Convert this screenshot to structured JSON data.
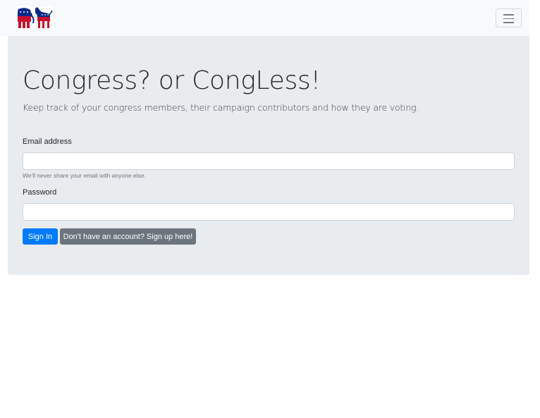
{
  "navbar": {
    "logo_icon": "elephant-donkey-logo",
    "toggler_icon": "hamburger-menu-icon"
  },
  "hero": {
    "title": "Congress? or CongLess!",
    "lead": "Keep track of your congress members, their campaign contributors and how they are voting."
  },
  "form": {
    "email_label": "Email address",
    "email_value": "",
    "email_help": "We'll never share your email with anyone else.",
    "password_label": "Password",
    "password_value": "",
    "signin_label": "Sign In",
    "signup_label": "Don't have an account? Sign up here!"
  },
  "colors": {
    "navbar_bg": "#f8f9fa",
    "jumbotron_bg": "#e9ecef",
    "primary": "#007bff",
    "secondary": "#6c757d",
    "logo_red": "#c8102e",
    "logo_blue": "#0a2a8a"
  }
}
